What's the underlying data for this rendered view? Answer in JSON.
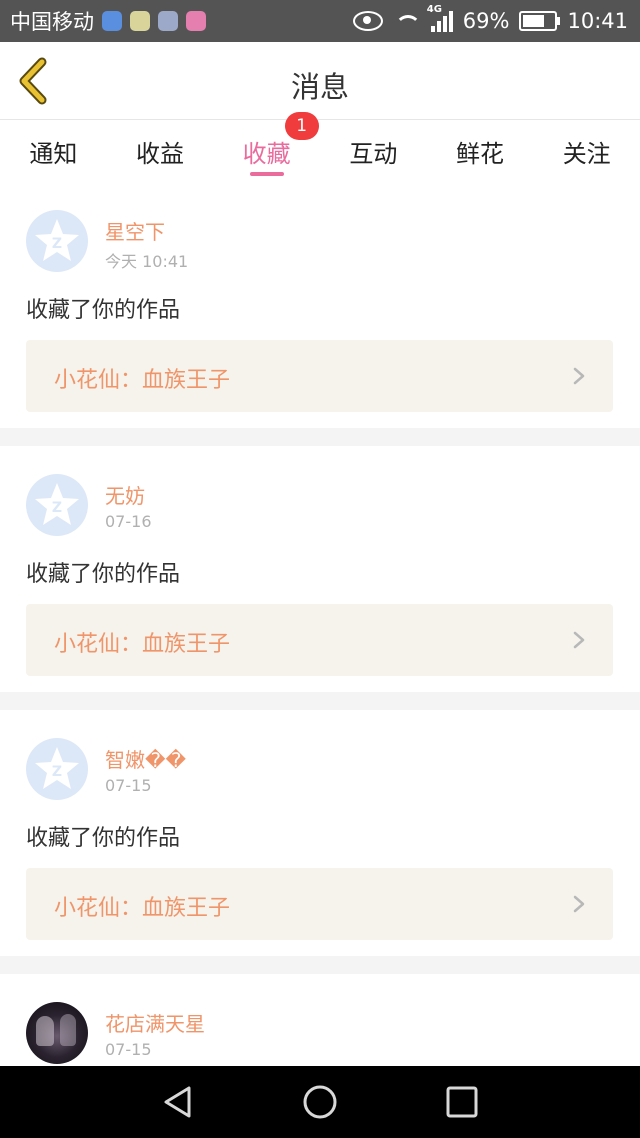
{
  "status_bar": {
    "carrier": "中国移动",
    "network_type": "4G",
    "battery_percent": "69%",
    "battery_level": 0.69,
    "time": "10:41",
    "app_icons": [
      "location-app-icon",
      "chat-app-icon",
      "music-app-icon",
      "game-app-icon"
    ]
  },
  "header": {
    "title": "消息",
    "back_icon": "chevron-left-icon"
  },
  "tabs": [
    {
      "label": "通知",
      "active": false
    },
    {
      "label": "收益",
      "active": false
    },
    {
      "label": "收藏",
      "active": true,
      "badge": "1"
    },
    {
      "label": "互动",
      "active": false
    },
    {
      "label": "鲜花",
      "active": false
    },
    {
      "label": "关注",
      "active": false
    }
  ],
  "messages": [
    {
      "user": "星空下",
      "time": "今天 10:41",
      "text": "收藏了你的作品",
      "work": "小花仙：血族王子",
      "avatar": "default-avatar-icon"
    },
    {
      "user": "无妨",
      "time": "07-16",
      "text": "收藏了你的作品",
      "work": "小花仙：血族王子",
      "avatar": "default-avatar-icon"
    },
    {
      "user": "智嫩��",
      "time": "07-15",
      "text": "收藏了你的作品",
      "work": "小花仙：血族王子",
      "avatar": "default-avatar-icon"
    },
    {
      "user": "花店满天星",
      "time": "07-15",
      "avatar": "photo-avatar"
    }
  ],
  "colors": {
    "accent": "#e96c9d",
    "badge": "#f03c3c",
    "name": "#f0956a",
    "back_icon": "#e8c233"
  },
  "nav_bar": {
    "buttons": [
      "back-triangle-icon",
      "home-circle-icon",
      "recents-square-icon"
    ]
  }
}
